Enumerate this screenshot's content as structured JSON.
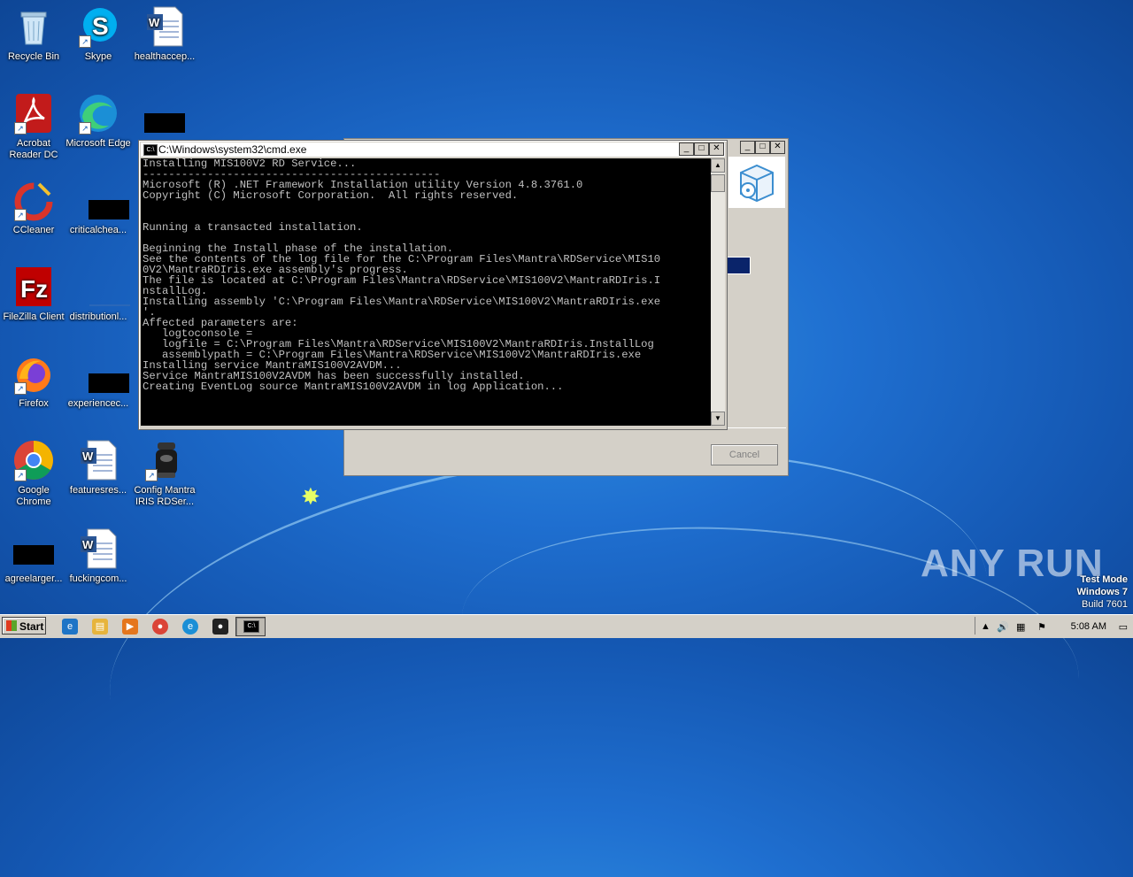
{
  "desktop": {
    "icons": [
      {
        "label": "Recycle Bin"
      },
      {
        "label": "Skype"
      },
      {
        "label": "healthaccep..."
      },
      {
        "label": "Acrobat Reader DC"
      },
      {
        "label": "Microsoft Edge"
      },
      {
        "label": "CCleaner"
      },
      {
        "label": "criticalchea..."
      },
      {
        "label": "FileZilla Client"
      },
      {
        "label": "distributionl..."
      },
      {
        "label": "Firefox"
      },
      {
        "label": "experiencec..."
      },
      {
        "label": "Google Chrome"
      },
      {
        "label": "featuresres..."
      },
      {
        "label": "Config Mantra IRIS RDSer..."
      },
      {
        "label": "agreelarger..."
      },
      {
        "label": "fuckingcom..."
      }
    ]
  },
  "cmd_window": {
    "title": "C:\\Windows\\system32\\cmd.exe",
    "console_text": "Installing MIS100V2 RD Service...\n----------------------------------------------\nMicrosoft (R) .NET Framework Installation utility Version 4.8.3761.0\nCopyright (C) Microsoft Corporation.  All rights reserved.\n\n\nRunning a transacted installation.\n\nBeginning the Install phase of the installation.\nSee the contents of the log file for the C:\\Program Files\\Mantra\\RDService\\MIS10\n0V2\\MantraRDIris.exe assembly's progress.\nThe file is located at C:\\Program Files\\Mantra\\RDService\\MIS100V2\\MantraRDIris.I\nnstallLog.\nInstalling assembly 'C:\\Program Files\\Mantra\\RDService\\MIS100V2\\MantraRDIris.exe\n'.\nAffected parameters are:\n   logtoconsole =\n   logfile = C:\\Program Files\\Mantra\\RDService\\MIS100V2\\MantraRDIris.InstallLog\n   assemblypath = C:\\Program Files\\Mantra\\RDService\\MIS100V2\\MantraRDIris.exe\nInstalling service MantraMIS100V2AVDM...\nService MantraMIS100V2AVDM has been successfully installed.\nCreating EventLog source MantraMIS100V2AVDM in log Application..."
  },
  "installer_window": {
    "cancel_label": "Cancel"
  },
  "watermark": {
    "brand": "ANY RUN",
    "line1": "Test Mode",
    "line2": "Windows 7",
    "line3": "Build 7601"
  },
  "taskbar": {
    "start_label": "Start",
    "clock": "5:08 AM"
  }
}
